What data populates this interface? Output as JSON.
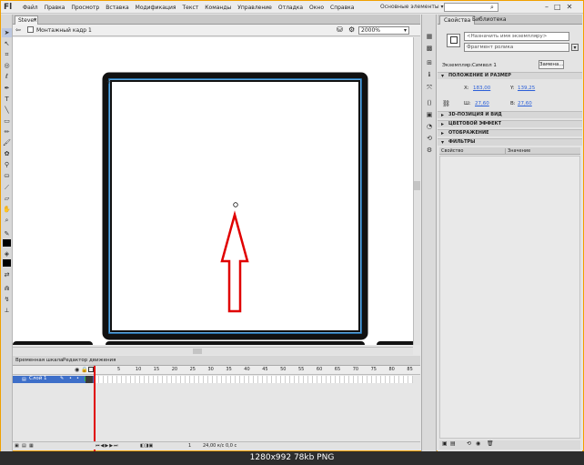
{
  "app": {
    "logo": "Fl",
    "menus": [
      "Файл",
      "Правка",
      "Просмотр",
      "Вставка",
      "Модификация",
      "Текст",
      "Команды",
      "Управление",
      "Отладка",
      "Окно",
      "Справка"
    ],
    "workspace": "Основные элементы ▾"
  },
  "document": {
    "tab": "Steve*",
    "scene": "Монтажный кадр 1",
    "zoom": "2000%"
  },
  "timeline": {
    "tab_timeline": "Временная шкала",
    "tab_motion": "Редактор движения",
    "frame_numbers": [
      "5",
      "10",
      "15",
      "20",
      "25",
      "30",
      "35",
      "40",
      "45",
      "50",
      "55",
      "60",
      "65",
      "70",
      "75",
      "80",
      "85"
    ],
    "layer_name": "Слой 1",
    "footer_fps": "24,00 к/с",
    "footer_time": "0,0 с",
    "footer_frame": "1"
  },
  "properties": {
    "tab_props": "Свойства",
    "tab_library": "Библиотека",
    "instance_name_placeholder": "<Назначить имя экземпляру>",
    "type": "Фрагмент ролика",
    "instance_label": "Экземпляр:",
    "instance_value": "Символ 1",
    "swap": "Замена...",
    "section_position": "ПОЛОЖЕНИЕ И РАЗМЕР",
    "x_label": "X:",
    "x_value": "183,00",
    "y_label": "Y:",
    "y_value": "139,25",
    "w_label": "Ш:",
    "w_value": "27,60",
    "h_label": "В:",
    "h_value": "27,60",
    "section_3d": "3D-ПОЗИЦИЯ И ВИД",
    "section_color": "ЦВЕТОВОЙ ЭФФЕКТ",
    "section_display": "ОТОБРАЖЕНИЕ",
    "section_filters": "ФИЛЬТРЫ",
    "col_property": "Свойство",
    "col_value": "Значение"
  },
  "footer": {
    "caption": "1280x992 78kb PNG"
  }
}
